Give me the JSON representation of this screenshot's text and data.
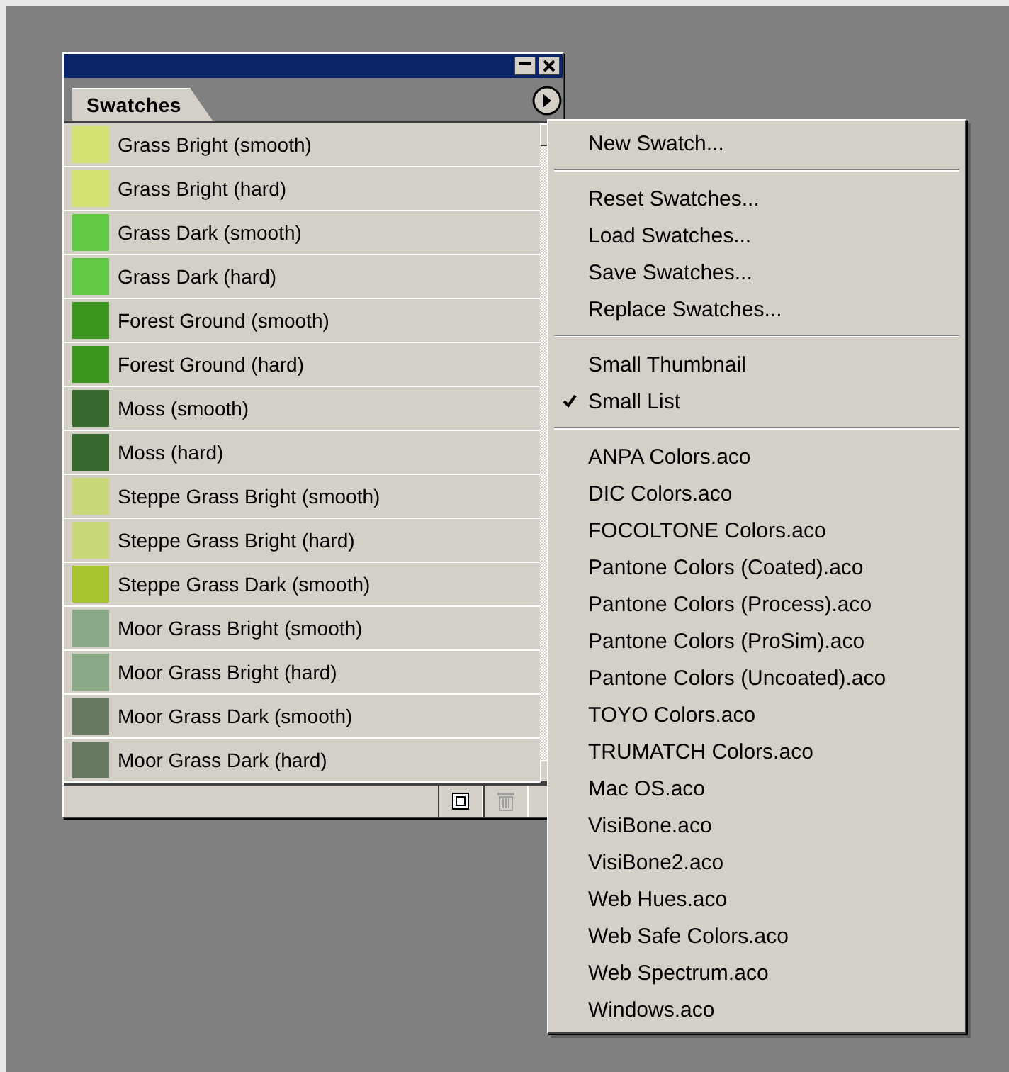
{
  "panel": {
    "tab": {
      "label": "Swatches",
      "selected": true
    },
    "swatches": [
      {
        "name": "Grass Bright (smooth)",
        "color": "#d3e173"
      },
      {
        "name": "Grass Bright (hard)",
        "color": "#d3e173"
      },
      {
        "name": "Grass Dark (smooth)",
        "color": "#62c944"
      },
      {
        "name": "Grass Dark (hard)",
        "color": "#62c944"
      },
      {
        "name": "Forest Ground (smooth)",
        "color": "#3b951e"
      },
      {
        "name": "Forest Ground (hard)",
        "color": "#3b951e"
      },
      {
        "name": "Moss (smooth)",
        "color": "#386a30"
      },
      {
        "name": "Moss (hard)",
        "color": "#386a30"
      },
      {
        "name": "Steppe Grass Bright (smooth)",
        "color": "#c9d97a"
      },
      {
        "name": "Steppe Grass Bright (hard)",
        "color": "#c9d97a"
      },
      {
        "name": "Steppe Grass Dark (smooth)",
        "color": "#a6c42e"
      },
      {
        "name": "Moor Grass Bright (smooth)",
        "color": "#88aa86"
      },
      {
        "name": "Moor Grass Bright (hard)",
        "color": "#88aa86"
      },
      {
        "name": "Moor Grass Dark (smooth)",
        "color": "#677a61"
      },
      {
        "name": "Moor Grass Dark (hard)",
        "color": "#677a61"
      }
    ],
    "footer_buttons": [
      {
        "kind": "new",
        "disabled": false
      },
      {
        "kind": "delete",
        "disabled": true
      }
    ]
  },
  "menu": {
    "sections": [
      [
        {
          "label": "New Swatch...",
          "checked": false
        }
      ],
      [
        {
          "label": "Reset Swatches...",
          "checked": false
        },
        {
          "label": "Load Swatches...",
          "checked": false
        },
        {
          "label": "Save Swatches...",
          "checked": false
        },
        {
          "label": "Replace Swatches...",
          "checked": false
        }
      ],
      [
        {
          "label": "Small Thumbnail",
          "checked": false
        },
        {
          "label": "Small List",
          "checked": true
        }
      ],
      [
        {
          "label": "ANPA Colors.aco",
          "checked": false
        },
        {
          "label": "DIC Colors.aco",
          "checked": false
        },
        {
          "label": "FOCOLTONE Colors.aco",
          "checked": false
        },
        {
          "label": "Pantone Colors (Coated).aco",
          "checked": false
        },
        {
          "label": "Pantone Colors (Process).aco",
          "checked": false
        },
        {
          "label": "Pantone Colors (ProSim).aco",
          "checked": false
        },
        {
          "label": "Pantone Colors (Uncoated).aco",
          "checked": false
        },
        {
          "label": "TOYO Colors.aco",
          "checked": false
        },
        {
          "label": "TRUMATCH Colors.aco",
          "checked": false
        },
        {
          "label": "Mac OS.aco",
          "checked": false
        },
        {
          "label": "VisiBone.aco",
          "checked": false
        },
        {
          "label": "VisiBone2.aco",
          "checked": false
        },
        {
          "label": "Web Hues.aco",
          "checked": false
        },
        {
          "label": "Web Safe Colors.aco",
          "checked": false
        },
        {
          "label": "Web Spectrum.aco",
          "checked": false
        },
        {
          "label": "Windows.aco",
          "checked": false
        }
      ]
    ]
  }
}
